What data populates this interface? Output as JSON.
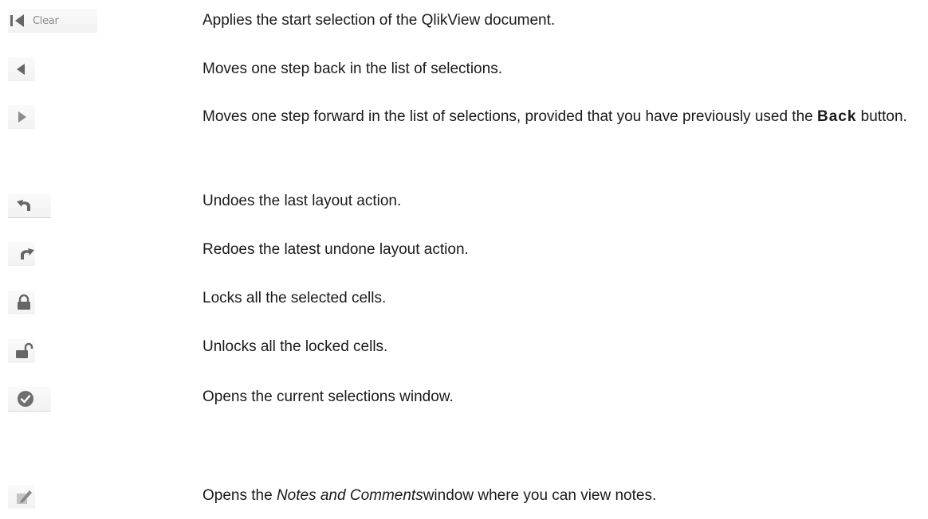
{
  "rows": [
    {
      "icon": "first-step-icon",
      "label": "Clear",
      "text": "Applies the start selection of the QlikView document."
    },
    {
      "icon": "back-arrow-icon",
      "text": "Moves one step back in the list of selections."
    },
    {
      "icon": "forward-arrow-icon",
      "text_before": "Moves one step forward in the list of selections, provided that you have previously used the ",
      "bold": "Back",
      "text_after": " button."
    },
    {
      "icon": "undo-icon",
      "text": "Undoes the last layout action."
    },
    {
      "icon": "redo-icon",
      "text": "Redoes the latest undone layout action."
    },
    {
      "icon": "lock-icon",
      "text": "Locks all the selected cells."
    },
    {
      "icon": "unlock-icon",
      "text": "Unlocks all the locked cells."
    },
    {
      "icon": "current-selections-icon",
      "text": "Opens the current selections window."
    },
    {
      "icon": "notes-pencil-icon",
      "text_before": "Opens the ",
      "italic": "Notes and Comments",
      "text_after": "window where you can view notes."
    }
  ],
  "colors": {
    "icon": "#6b6b6b",
    "icon_light": "#9a9a9a",
    "text": "#1a1a1a"
  }
}
